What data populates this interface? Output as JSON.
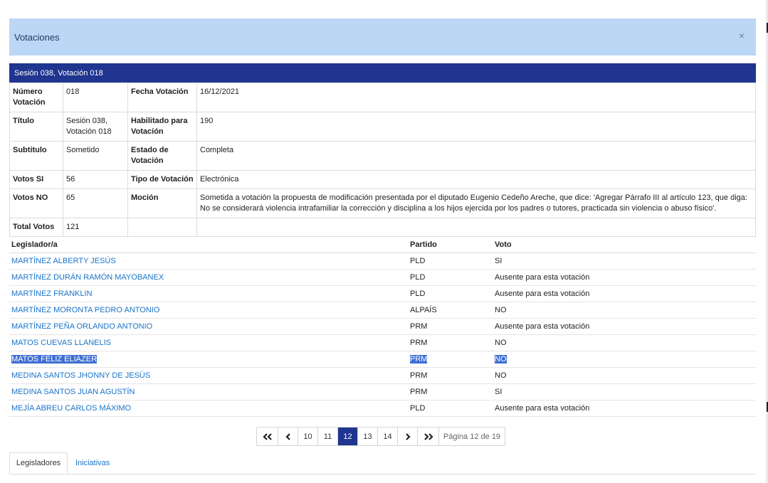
{
  "modal": {
    "title": "Votaciones",
    "close_glyph": "×"
  },
  "session_header": "Sesión 038, Votación 018",
  "details": {
    "numero_label": "Número Votación",
    "numero_value": "018",
    "fecha_label": "Fecha Votación",
    "fecha_value": "16/12/2021",
    "titulo_label": "Título",
    "titulo_value": "Sesión 038, Votación 018",
    "habilitado_label": "Habilitado para Votación",
    "habilitado_value": "190",
    "subtitulo_label": "Subtitulo",
    "subtitulo_value": "Sometido",
    "estado_label": "Estado de Votación",
    "estado_value": "Completa",
    "votos_si_label": "Votos SI",
    "votos_si_value": "56",
    "tipo_label": "Tipo de Votación",
    "tipo_value": "Electrónica",
    "votos_no_label": "Votos NO",
    "votos_no_value": "65",
    "mocion_label": "Moción",
    "mocion_value": "Sometida a votación la propuesta de modificación presentada por el diputado Eugenio Cedeño Areche, que dice: 'Agregar Párrafo III al artículo 123, que diga: No se considerará violencia intrafamiliar la corrección y disciplina a los hijos ejercida por los padres o tutores, practicada sin violencia o abuso físico'.",
    "total_label": "Total Votos",
    "total_value": "121"
  },
  "votes_table": {
    "headers": {
      "legislador": "Legislador/a",
      "partido": "Partido",
      "voto": "Voto"
    },
    "rows": [
      {
        "name": "MARTÍNEZ ALBERTY JESÚS",
        "party": "PLD",
        "vote": "SI"
      },
      {
        "name": "MARTÍNEZ DURÁN RAMÓN MAYOBANEX",
        "party": "PLD",
        "vote": "Ausente para esta votación"
      },
      {
        "name": "MARTÍNEZ FRANKLIN",
        "party": "PLD",
        "vote": "Ausente para esta votación"
      },
      {
        "name": "MARTÍNEZ MORONTA PEDRO ANTONIO",
        "party": "ALPAÍS",
        "vote": "NO"
      },
      {
        "name": "MARTÍNEZ PEÑA ORLANDO ANTONIO",
        "party": "PRM",
        "vote": "Ausente para esta votación"
      },
      {
        "name": "MATOS CUEVAS LLANELIS",
        "party": "PRM",
        "vote": "NO"
      },
      {
        "name": "MATOS FÉLIZ ELIAZER",
        "party": "PRM",
        "vote": "NO"
      },
      {
        "name": "MEDINA SANTOS JHONNY DE JESÚS",
        "party": "PRM",
        "vote": "NO"
      },
      {
        "name": "MEDINA SANTOS JUAN AGUSTÍN",
        "party": "PRM",
        "vote": "SI"
      },
      {
        "name": "MEJÍA ABREU CARLOS MÁXIMO",
        "party": "PLD",
        "vote": "Ausente para esta votación"
      }
    ]
  },
  "pagination": {
    "pages": [
      "10",
      "11",
      "12",
      "13",
      "14"
    ],
    "current": "12",
    "info": "Página 12 de 19"
  },
  "tabs": {
    "legisladores": "Legisladores",
    "iniciativas": "Iniciativas"
  },
  "colors": {
    "header_bg": "#bcd6f5",
    "session_bar": "#1f3590",
    "link": "#1a73c8",
    "selection": "#3f6ed3"
  }
}
